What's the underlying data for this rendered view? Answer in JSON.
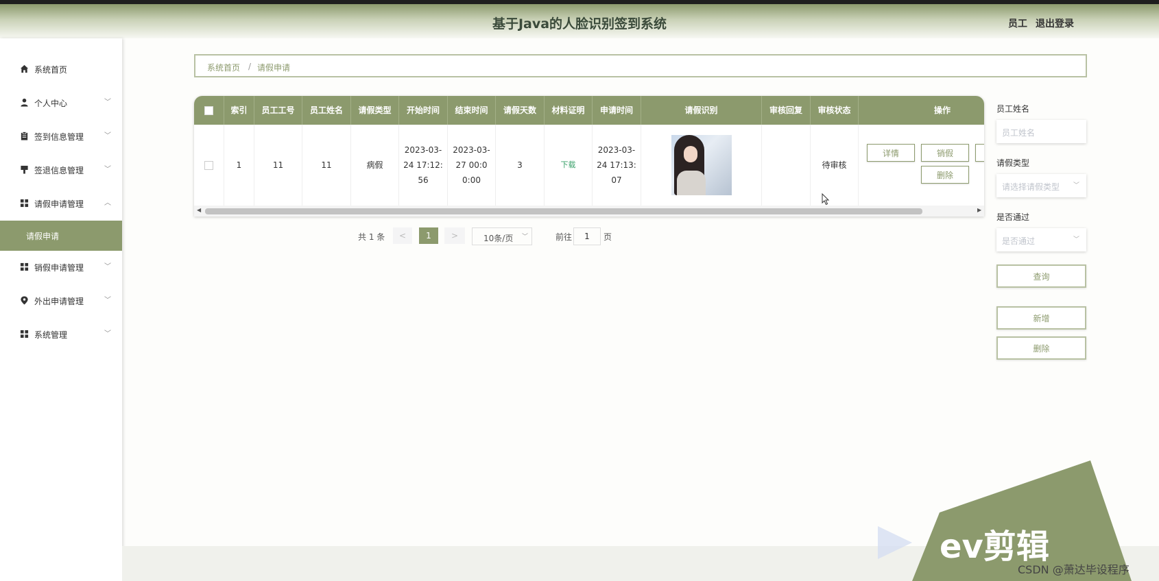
{
  "header": {
    "title": "基于Java的人脸识别签到系统",
    "user": "员工",
    "logout": "退出登录"
  },
  "sidebar": {
    "items": [
      {
        "label": "系统首页",
        "icon": "home-icon"
      },
      {
        "label": "个人中心",
        "icon": "user-icon"
      },
      {
        "label": "签到信息管理",
        "icon": "clipboard-icon"
      },
      {
        "label": "签退信息管理",
        "icon": "stamp-icon"
      },
      {
        "label": "请假申请管理",
        "icon": "grid-icon"
      },
      {
        "label": "销假申请管理",
        "icon": "grid-icon"
      },
      {
        "label": "外出申请管理",
        "icon": "location-icon"
      },
      {
        "label": "系统管理",
        "icon": "grid-icon"
      }
    ],
    "active_sub": "请假申请"
  },
  "breadcrumb": {
    "home": "系统首页",
    "separator": "/",
    "current": "请假申请"
  },
  "table": {
    "columns": [
      "索引",
      "员工工号",
      "员工姓名",
      "请假类型",
      "开始时间",
      "结束时间",
      "请假天数",
      "材料证明",
      "申请时间",
      "请假识别",
      "审核回复",
      "审核状态",
      "操作"
    ],
    "rows": [
      {
        "index": "1",
        "emp_no": "11",
        "emp_name": "11",
        "leave_type": "病假",
        "start_time": "2023-03-24 17:12:56",
        "end_time": "2023-03-27 00:00:00",
        "days": "3",
        "material": "下载",
        "apply_time": "2023-03-24 17:13:07",
        "reply": "",
        "status": "待审核",
        "actions": {
          "detail": "详情",
          "cancel": "销假",
          "delete": "删除"
        }
      }
    ]
  },
  "pagination": {
    "total": "共 1 条",
    "prev": "<",
    "page": "1",
    "next": ">",
    "page_size": "10条/页",
    "goto_label": "前往",
    "goto_value": "1",
    "page_label": "页"
  },
  "filters": {
    "name_label": "员工姓名",
    "name_placeholder": "员工姓名",
    "type_label": "请假类型",
    "type_placeholder": "请选择请假类型",
    "pass_label": "是否通过",
    "pass_placeholder": "是否通过",
    "query_button": "查询",
    "add_button": "新增",
    "delete_button": "删除"
  },
  "watermark": {
    "brand": "ev剪辑",
    "credit": "CSDN @萧达毕设程序"
  },
  "colors": {
    "accent": "#8c9a6d",
    "download": "#3aa06a"
  }
}
